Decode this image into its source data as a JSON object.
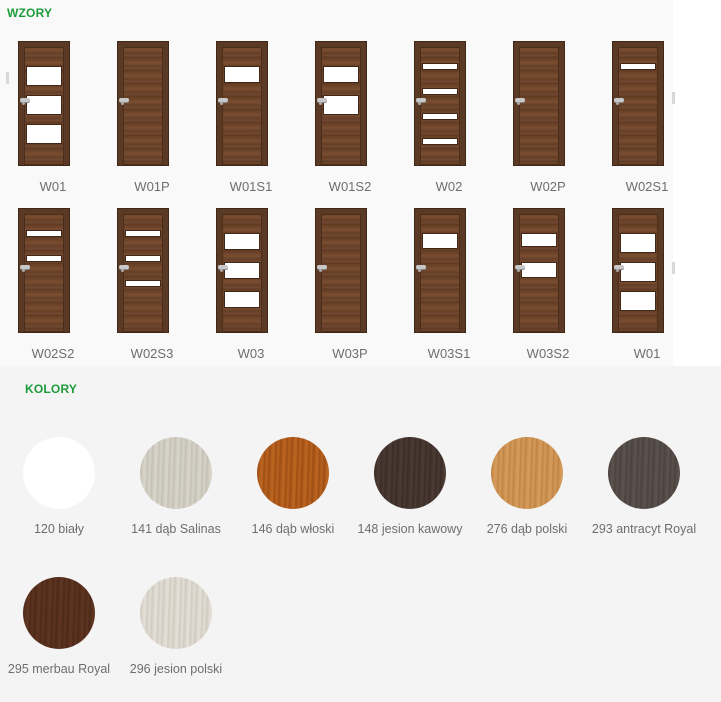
{
  "sections": {
    "wzory_title": "WZORY",
    "kolory_title": "KOLORY"
  },
  "doors": [
    {
      "label": "W01",
      "glass": [
        3,
        3,
        3
      ],
      "glass_type": "large3"
    },
    {
      "label": "W01P",
      "glass": [],
      "glass_type": "none"
    },
    {
      "label": "W01S1",
      "glass": [
        1
      ],
      "glass_type": "large"
    },
    {
      "label": "W01S2",
      "glass": [
        2
      ],
      "glass_type": "large"
    },
    {
      "label": "W02",
      "glass": [
        4
      ],
      "glass_type": "slim4"
    },
    {
      "label": "W02P",
      "glass": [],
      "glass_type": "none"
    },
    {
      "label": "W02S1",
      "glass": [
        1
      ],
      "glass_type": "slim1"
    },
    {
      "label": "W02S2",
      "glass": [
        2
      ],
      "glass_type": "slim2"
    },
    {
      "label": "W02S3",
      "glass": [
        3
      ],
      "glass_type": "slim3"
    },
    {
      "label": "W03",
      "glass": [
        3
      ],
      "glass_type": "large3"
    },
    {
      "label": "W03P",
      "glass": [],
      "glass_type": "none"
    },
    {
      "label": "W03S1",
      "glass": [
        1
      ],
      "glass_type": "large1"
    },
    {
      "label": "W03S2",
      "glass": [
        2
      ],
      "glass_type": "large2"
    },
    {
      "label": "W01",
      "glass": [
        3
      ],
      "glass_type": "large3"
    }
  ],
  "colors": [
    {
      "label": "120 biały",
      "color": "#ffffff",
      "grain": "#ffffff"
    },
    {
      "label": "141 dąb Salinas",
      "color": "#d6d3c8",
      "grain": "#c4c0b4"
    },
    {
      "label": "146 dąb włoski",
      "color": "#b9631f",
      "grain": "#9d4d14"
    },
    {
      "label": "148 jesion kawowy",
      "color": "#4a3a33",
      "grain": "#3a2c26"
    },
    {
      "label": "276 dąb polski",
      "color": "#d49a5a",
      "grain": "#c08544"
    },
    {
      "label": "293 antracyt Royal",
      "color": "#5a514c",
      "grain": "#4a423e"
    },
    {
      "label": "295 merbau Royal",
      "color": "#5e3420",
      "grain": "#4d2818"
    },
    {
      "label": "296 jesion polski",
      "color": "#e2ded5",
      "grain": "#d0cbc0"
    }
  ]
}
